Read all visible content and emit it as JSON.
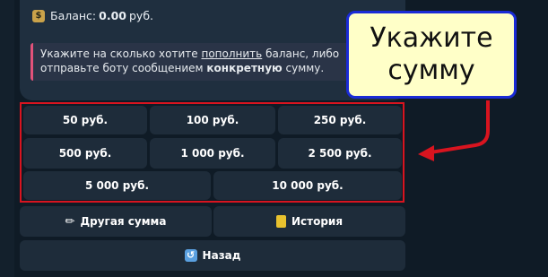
{
  "message": {
    "balance_label": "Баланс:",
    "balance_value": "0.00",
    "balance_currency": "руб.",
    "money_icon": "money-bag-icon",
    "quote_part1": "Укажите на сколько хотите ",
    "quote_link": "пополнить",
    "quote_part2": " баланс, либо отправьте боту сообщением ",
    "quote_bold": "конкретную",
    "quote_part3": " сумму."
  },
  "amounts": {
    "a50": "50 руб.",
    "a100": "100 руб.",
    "a250": "250 руб.",
    "a500": "500 руб.",
    "a1000": "1 000 руб.",
    "a2500": "2 500 руб.",
    "a5000": "5 000 руб.",
    "a10000": "10 000 руб."
  },
  "actions": {
    "other": "Другая сумма",
    "history": "История",
    "back": "Назад"
  },
  "callout": {
    "line1": "Укажите",
    "line2": "сумму"
  },
  "colors": {
    "highlight_frame": "#d8141f",
    "callout_border": "#1a2bd6",
    "callout_bg": "#ffffc8",
    "arrow": "#d8141f"
  }
}
